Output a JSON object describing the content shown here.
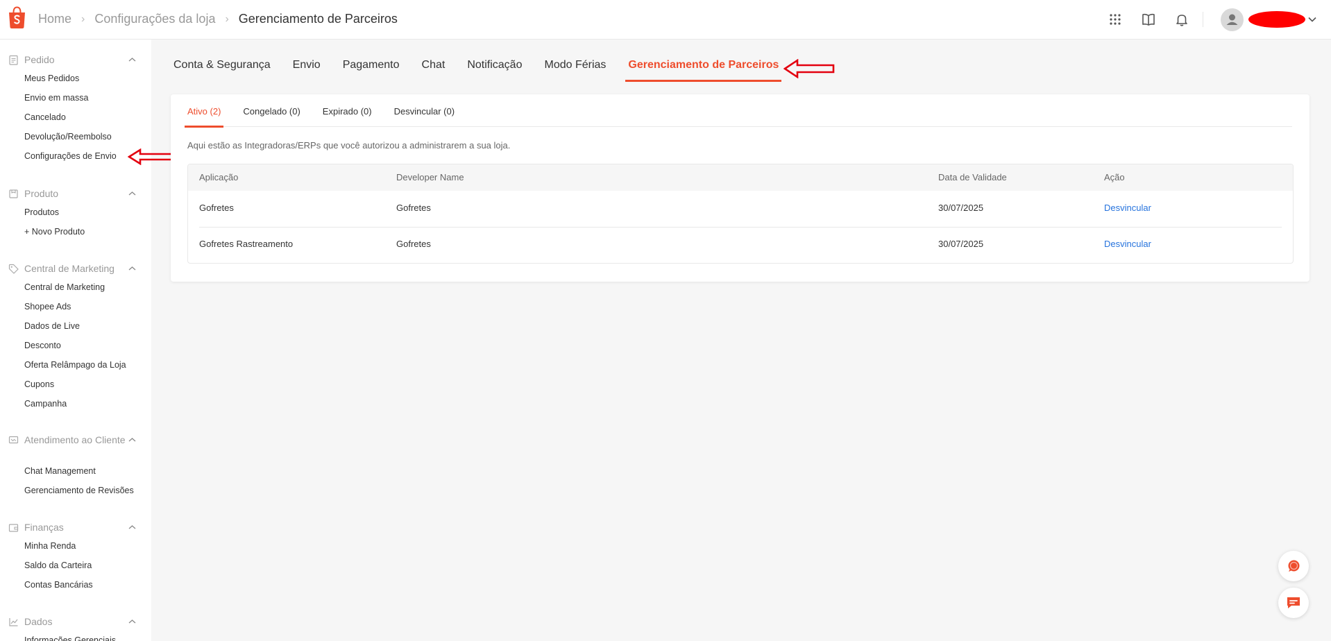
{
  "breadcrumb": {
    "home": "Home",
    "store_settings": "Configurações da loja",
    "current": "Gerenciamento de Parceiros"
  },
  "header": {
    "icons": [
      "apps-grid-icon",
      "book-icon",
      "bell-icon",
      "user-avatar-icon",
      "chevron-down-icon"
    ]
  },
  "sidebar": {
    "sections": [
      {
        "title": "Pedido",
        "icon": "clipboard-icon",
        "items": [
          "Meus Pedidos",
          "Envio em massa",
          "Cancelado",
          "Devolução/Reembolso",
          "Configurações de Envio"
        ]
      },
      {
        "title": "Produto",
        "icon": "box-icon",
        "items": [
          "Produtos",
          "+ Novo Produto"
        ]
      },
      {
        "title": "Central de Marketing",
        "icon": "tag-icon",
        "items": [
          "Central de Marketing",
          "Shopee Ads",
          "Dados de Live",
          "Desconto",
          "Oferta Relâmpago da Loja",
          "Cupons",
          "Campanha"
        ]
      },
      {
        "title": "Atendimento ao Cliente",
        "icon": "chat-box-icon",
        "items": [
          "Chat Management",
          "Gerenciamento de Revisões"
        ]
      },
      {
        "title": "Finanças",
        "icon": "wallet-icon",
        "items": [
          "Minha Renda",
          "Saldo da Carteira",
          "Contas Bancárias"
        ]
      },
      {
        "title": "Dados",
        "icon": "line-chart-icon",
        "items": [
          "Informações Gerenciais"
        ]
      }
    ]
  },
  "main_tabs": [
    "Conta & Segurança",
    "Envio",
    "Pagamento",
    "Chat",
    "Notificação",
    "Modo Férias",
    "Gerenciamento de Parceiros"
  ],
  "main_tabs_active_index": 6,
  "sub_tabs": [
    "Ativo (2)",
    "Congelado (0)",
    "Expirado (0)",
    "Desvincular (0)"
  ],
  "sub_tabs_active_index": 0,
  "description": "Aqui estão as Integradoras/ERPs que você autorizou a administrarem a sua loja.",
  "table": {
    "headers": [
      "Aplicação",
      "Developer Name",
      "Data de Validade",
      "Ação"
    ],
    "rows": [
      [
        "Gofretes",
        "Gofretes",
        "30/07/2025",
        "Desvincular"
      ],
      [
        "Gofretes Rastreamento",
        "Gofretes",
        "30/07/2025",
        "Desvincular"
      ]
    ]
  },
  "colors": {
    "brand": "#ee4d2d",
    "link": "#2673dd",
    "annotation_arrow": "#e3000f"
  }
}
